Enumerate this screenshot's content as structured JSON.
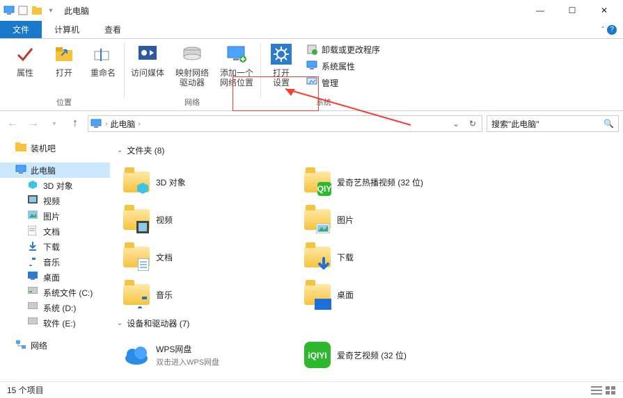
{
  "title": "此电脑",
  "win": {
    "min": "—",
    "max": "☐",
    "close": "✕"
  },
  "tabs": {
    "file": "文件",
    "computer": "计算机",
    "view": "查看"
  },
  "ribbon": {
    "group_location": "位置",
    "group_network": "网络",
    "group_system": "系统",
    "properties": "属性",
    "open": "打开",
    "rename": "重命名",
    "media": "访问媒体",
    "map_drive": "映射网络\n驱动器",
    "add_netloc": "添加一个\n网络位置",
    "open_settings": "打开\n设置",
    "uninstall": "卸载或更改程序",
    "sys_props": "系统属性",
    "manage": "管理"
  },
  "breadcrumb": {
    "root": "此电脑"
  },
  "search_placeholder": "搜索\"此电脑\"",
  "sidebar": {
    "zhuangji": "装机吧",
    "this_pc": "此电脑",
    "obj3d": "3D 对象",
    "video": "视频",
    "pictures": "图片",
    "documents": "文档",
    "downloads": "下载",
    "music": "音乐",
    "desktop": "桌面",
    "sysfiles": "系统文件 (C:)",
    "sysd": "系统 (D:)",
    "softe": "软件 (E:)",
    "network": "网络"
  },
  "sections": {
    "folders_hdr": "文件夹 (8)",
    "devices_hdr": "设备和驱动器 (7)"
  },
  "folders": [
    {
      "label": "3D 对象"
    },
    {
      "label": "爱奇艺热播视频 (32 位)"
    },
    {
      "label": "视频"
    },
    {
      "label": "图片"
    },
    {
      "label": "文档"
    },
    {
      "label": "下载"
    },
    {
      "label": "音乐"
    },
    {
      "label": "桌面"
    }
  ],
  "devices": [
    {
      "label": "WPS网盘",
      "sub": "双击进入WPS网盘"
    },
    {
      "label": "爱奇艺视频 (32 位)"
    }
  ],
  "status": "15 个项目"
}
